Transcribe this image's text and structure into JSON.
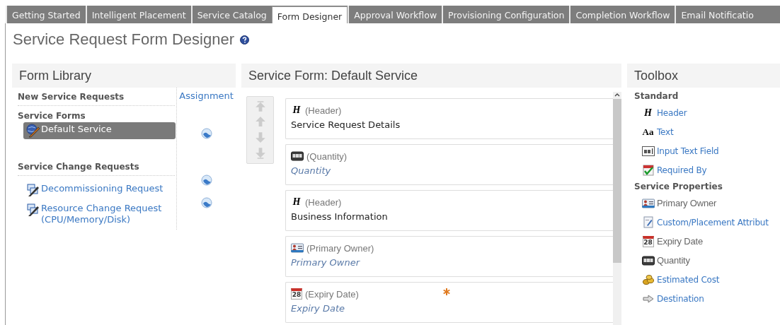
{
  "tabs": [
    {
      "label": "Getting Started",
      "selected": false
    },
    {
      "label": "Intelligent Placement",
      "selected": false
    },
    {
      "label": "Service Catalog",
      "selected": false
    },
    {
      "label": "Form Designer",
      "selected": true
    },
    {
      "label": "Approval Workflow",
      "selected": false
    },
    {
      "label": "Provisioning Configuration",
      "selected": false
    },
    {
      "label": "Completion Workflow",
      "selected": false
    },
    {
      "label": "Email Notificatio",
      "selected": false
    }
  ],
  "page_title": "Service Request Form Designer",
  "form_library": {
    "title": "Form Library",
    "assignment_header": "Assignment",
    "sections": [
      {
        "title": "New Service Requests",
        "subtitle": "Service Forms",
        "items": [
          {
            "kind": "service",
            "label": "Default Service",
            "selected": true
          }
        ]
      },
      {
        "title": "Service Change Requests",
        "items": [
          {
            "kind": "change",
            "label": "Decommissioning Request",
            "selected": false
          },
          {
            "kind": "change",
            "label": "Resource Change Request (CPU/Memory/Disk)",
            "selected": false
          }
        ]
      }
    ]
  },
  "service_form": {
    "title": "Service Form: Default Service",
    "fields": [
      {
        "kind": "header",
        "glyph": "H",
        "type_label": "(Header)",
        "label": "Service Request Details",
        "required": false
      },
      {
        "kind": "quantity",
        "type_label": "(Quantity)",
        "label": "Quantity",
        "required": false
      },
      {
        "kind": "header",
        "glyph": "H",
        "type_label": "(Header)",
        "label": "Business Information",
        "required": false
      },
      {
        "kind": "owner",
        "type_label": "(Primary Owner)",
        "label": "Primary Owner",
        "required": false
      },
      {
        "kind": "date",
        "glyph": "28",
        "type_label": "(Expiry Date)",
        "label": "Expiry Date",
        "required": true
      }
    ]
  },
  "toolbox": {
    "title": "Toolbox",
    "groups": [
      {
        "title": "Standard",
        "items": [
          {
            "kind": "header",
            "glyph": "H",
            "label": "Header",
            "disabled": false
          },
          {
            "kind": "text",
            "glyph": "Aa",
            "label": "Text",
            "disabled": false
          },
          {
            "kind": "input",
            "label": "Input Text Field",
            "disabled": false
          },
          {
            "kind": "due",
            "label": "Required By",
            "disabled": false
          }
        ]
      },
      {
        "title": "Service Properties",
        "items": [
          {
            "kind": "owner",
            "label": "Primary Owner",
            "disabled": true
          },
          {
            "kind": "custom",
            "label": "Custom/Placement Attribut",
            "disabled": false
          },
          {
            "kind": "date",
            "glyph": "28",
            "label": "Expiry Date",
            "disabled": true
          },
          {
            "kind": "quantity",
            "label": "Quantity",
            "disabled": true
          },
          {
            "kind": "cost",
            "label": "Estimated Cost",
            "disabled": false
          },
          {
            "kind": "destination",
            "label": "Destination",
            "disabled": false
          }
        ]
      }
    ]
  }
}
